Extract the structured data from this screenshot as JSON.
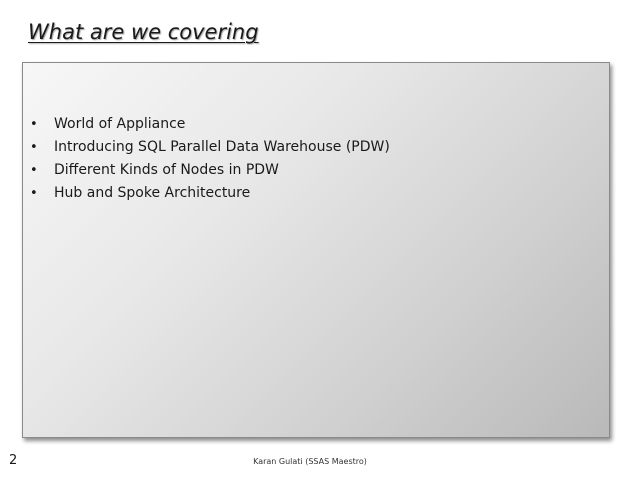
{
  "slide": {
    "title": "What are we covering",
    "bullet_marker": "•",
    "bullets": [
      "World of Appliance",
      "Introducing SQL Parallel Data Warehouse (PDW)",
      "Different Kinds of Nodes in PDW",
      "Hub and Spoke Architecture"
    ],
    "page_number": "2",
    "footer": "Karan Gulati (SSAS Maestro)"
  }
}
